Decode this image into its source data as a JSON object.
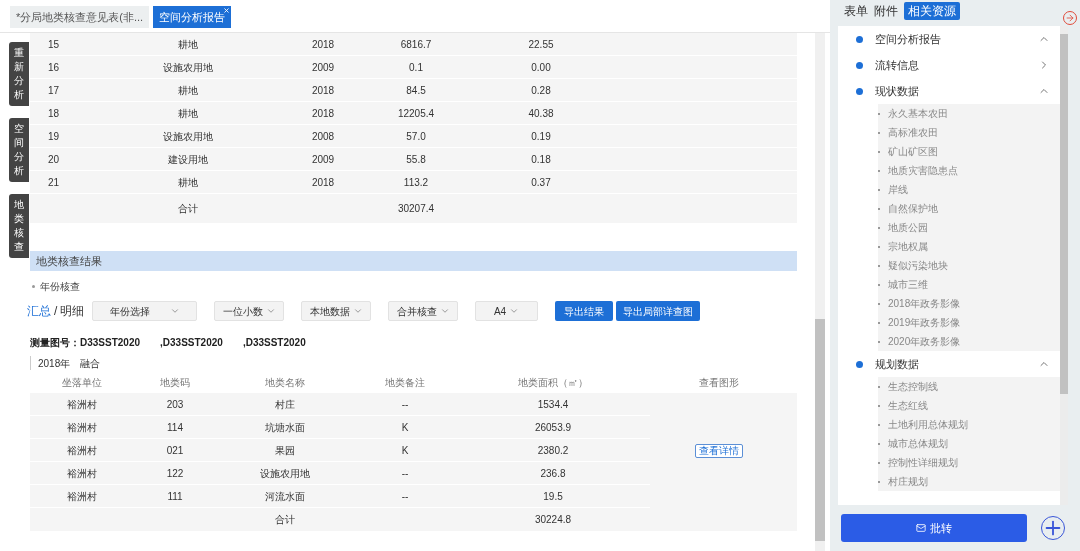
{
  "tabs": [
    {
      "label": "*分局地类核查意见表(非...",
      "selected": false,
      "closable": false
    },
    {
      "label": "空间分析报告",
      "selected": true,
      "closable": true
    }
  ],
  "side_buttons": [
    "重新分析",
    "空间分析",
    "地类核查"
  ],
  "upper_table": {
    "rows": [
      [
        "15",
        "耕地",
        "2018",
        "6816.7",
        "22.55"
      ],
      [
        "16",
        "设施农用地",
        "2009",
        "0.1",
        "0.00"
      ],
      [
        "17",
        "耕地",
        "2018",
        "84.5",
        "0.28"
      ],
      [
        "18",
        "耕地",
        "2018",
        "12205.4",
        "40.38"
      ],
      [
        "19",
        "设施农用地",
        "2008",
        "57.0",
        "0.19"
      ],
      [
        "20",
        "建设用地",
        "2009",
        "55.8",
        "0.18"
      ],
      [
        "21",
        "耕地",
        "2018",
        "113.2",
        "0.37"
      ]
    ],
    "total": {
      "label": "合计",
      "area": "30207.4"
    }
  },
  "section_title": "地类核查结果",
  "check_item": "年份核查",
  "view_toggle": {
    "options": [
      {
        "label": "汇总",
        "selected": true
      },
      {
        "label": "明细",
        "selected": false
      }
    ],
    "separator": "/"
  },
  "dropdowns": [
    "年份选择",
    "一位小数",
    "本地数据",
    "合并核查",
    "A4"
  ],
  "buttons": [
    "导出结果",
    "导出局部详查图"
  ],
  "sheet_numbers": {
    "label": "测量图号：",
    "values": [
      "D33SST2020",
      ",D33SST2020",
      ",D33SST2020"
    ]
  },
  "year_header": {
    "year": "2018年",
    "mode": "融合"
  },
  "result_table": {
    "columns": [
      "坐落单位",
      "地类码",
      "地类名称",
      "地类备注",
      "地类面积（㎡）",
      "查看图形"
    ],
    "rows": [
      [
        "裕洲村",
        "203",
        "村庄",
        "--",
        "1534.4"
      ],
      [
        "裕洲村",
        "114",
        "坑塘水面",
        "K",
        "26053.9"
      ],
      [
        "裕洲村",
        "021",
        "果园",
        "K",
        "2380.2"
      ],
      [
        "裕洲村",
        "122",
        "设施农用地",
        "--",
        "236.8"
      ],
      [
        "裕洲村",
        "111",
        "河流水面",
        "--",
        "19.5"
      ]
    ],
    "detail_button": "查看详情",
    "total": {
      "label": "合计",
      "area": "30224.8"
    }
  },
  "panel_tabs": [
    {
      "label": "表单",
      "selected": false
    },
    {
      "label": "附件",
      "selected": false
    },
    {
      "label": "相关资源",
      "selected": true
    }
  ],
  "resources": [
    {
      "label": "空间分析报告",
      "expanded": true
    },
    {
      "label": "流转信息",
      "expanded": false
    },
    {
      "label": "现状数据",
      "expanded": true,
      "children": [
        "永久基本农田",
        "高标准农田",
        "矿山矿区图",
        "地质灾害隐患点",
        "岸线",
        "自然保护地",
        "地质公园",
        "宗地权属",
        "疑似污染地块",
        "城市三维",
        "2018年政务影像",
        "2019年政务影像",
        "2020年政务影像"
      ]
    },
    {
      "label": "规划数据",
      "expanded": true,
      "children": [
        "生态控制线",
        "生态红线",
        "土地利用总体规划",
        "城市总体规划",
        "控制性详细规划",
        "村庄规划"
      ]
    }
  ],
  "action_button": "批转"
}
